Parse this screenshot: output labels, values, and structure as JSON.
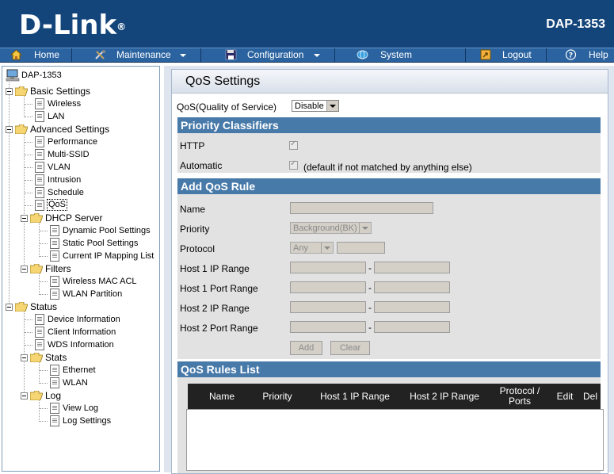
{
  "header": {
    "brand": "D-Link",
    "model": "DAP-1353"
  },
  "menu": [
    {
      "label": "Home",
      "icon": "home-icon"
    },
    {
      "label": "Maintenance",
      "icon": "tools-icon"
    },
    {
      "label": "Configuration",
      "icon": "floppy-icon"
    },
    {
      "label": "System",
      "icon": "network-icon"
    },
    {
      "label": "Logout",
      "icon": "logout-icon"
    },
    {
      "label": "Help",
      "icon": "help-icon"
    }
  ],
  "tree": {
    "root": "DAP-1353",
    "basic": {
      "label": "Basic Settings",
      "items": [
        "Wireless",
        "LAN"
      ]
    },
    "advanced": {
      "label": "Advanced Settings",
      "items": [
        "Performance",
        "Multi-SSID",
        "VLAN",
        "Intrusion",
        "Schedule",
        "QoS"
      ],
      "dhcp": {
        "label": "DHCP Server",
        "items": [
          "Dynamic Pool Settings",
          "Static Pool Settings",
          "Current IP Mapping List"
        ]
      },
      "filters": {
        "label": "Filters",
        "items": [
          "Wireless MAC ACL",
          "WLAN Partition"
        ]
      }
    },
    "status": {
      "label": "Status",
      "items": [
        "Device Information",
        "Client Information",
        "WDS Information"
      ],
      "stats": {
        "label": "Stats",
        "items": [
          "Ethernet",
          "WLAN"
        ]
      },
      "log": {
        "label": "Log",
        "items": [
          "View Log",
          "Log Settings"
        ]
      }
    }
  },
  "page": {
    "title": "QoS Settings",
    "qos_label": "QoS(Quality of Service)",
    "qos_value": "Disable",
    "priority_classifiers": {
      "heading": "Priority Classifiers",
      "http_label": "HTTP",
      "automatic_label": "Automatic",
      "automatic_note": "(default if not matched by anything else)"
    },
    "add_rule": {
      "heading": "Add QoS Rule",
      "name_label": "Name",
      "priority_label": "Priority",
      "priority_value": "Background(BK)",
      "protocol_label": "Protocol",
      "protocol_value": "Any",
      "host1_ip_label": "Host 1 IP Range",
      "host1_port_label": "Host 1 Port Range",
      "host2_ip_label": "Host 2 IP Range",
      "host2_port_label": "Host 2 Port Range",
      "dash": "-",
      "add_button": "Add",
      "clear_button": "Clear"
    },
    "rules_list": {
      "heading": "QoS Rules List",
      "columns": [
        "Name",
        "Priority",
        "Host 1 IP Range",
        "Host 2 IP Range",
        "Protocol / Ports",
        "Edit",
        "Del"
      ]
    }
  }
}
